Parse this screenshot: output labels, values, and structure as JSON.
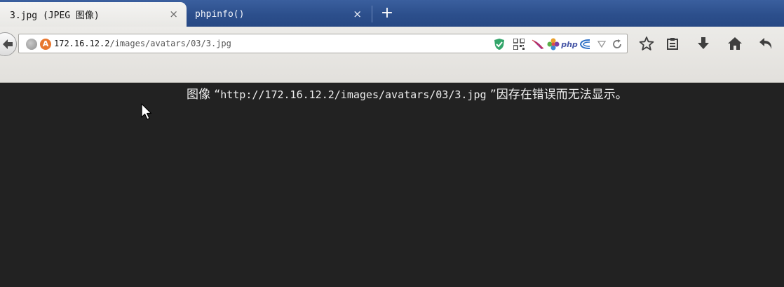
{
  "tabs": [
    {
      "title": "3.jpg (JPEG 图像)",
      "close": "×"
    },
    {
      "title": "phpinfo()",
      "close": "×"
    }
  ],
  "new_tab_label": "+",
  "address": {
    "host": "172.16.12.2",
    "path": "/images/avatars/03/3.jpg"
  },
  "extensions": [
    "shield-check-icon",
    "qr-code-icon",
    "feather-icon",
    "flower-icon",
    "php-icon",
    "w3c-icon"
  ],
  "php_ext_label": "php",
  "toolbar_icons": [
    "star-icon",
    "clipboard-icon",
    "download-icon",
    "home-icon",
    "undo-icon"
  ],
  "message": {
    "prefix": "图像 “",
    "url": "http://172.16.12.2/images/avatars/03/3.jpg",
    "suffix": " ”因存在错误而无法显示。"
  },
  "colors": {
    "tabstrip": "#2c4f8c",
    "content_bg": "#222222",
    "message_text": "#eeeeee"
  }
}
